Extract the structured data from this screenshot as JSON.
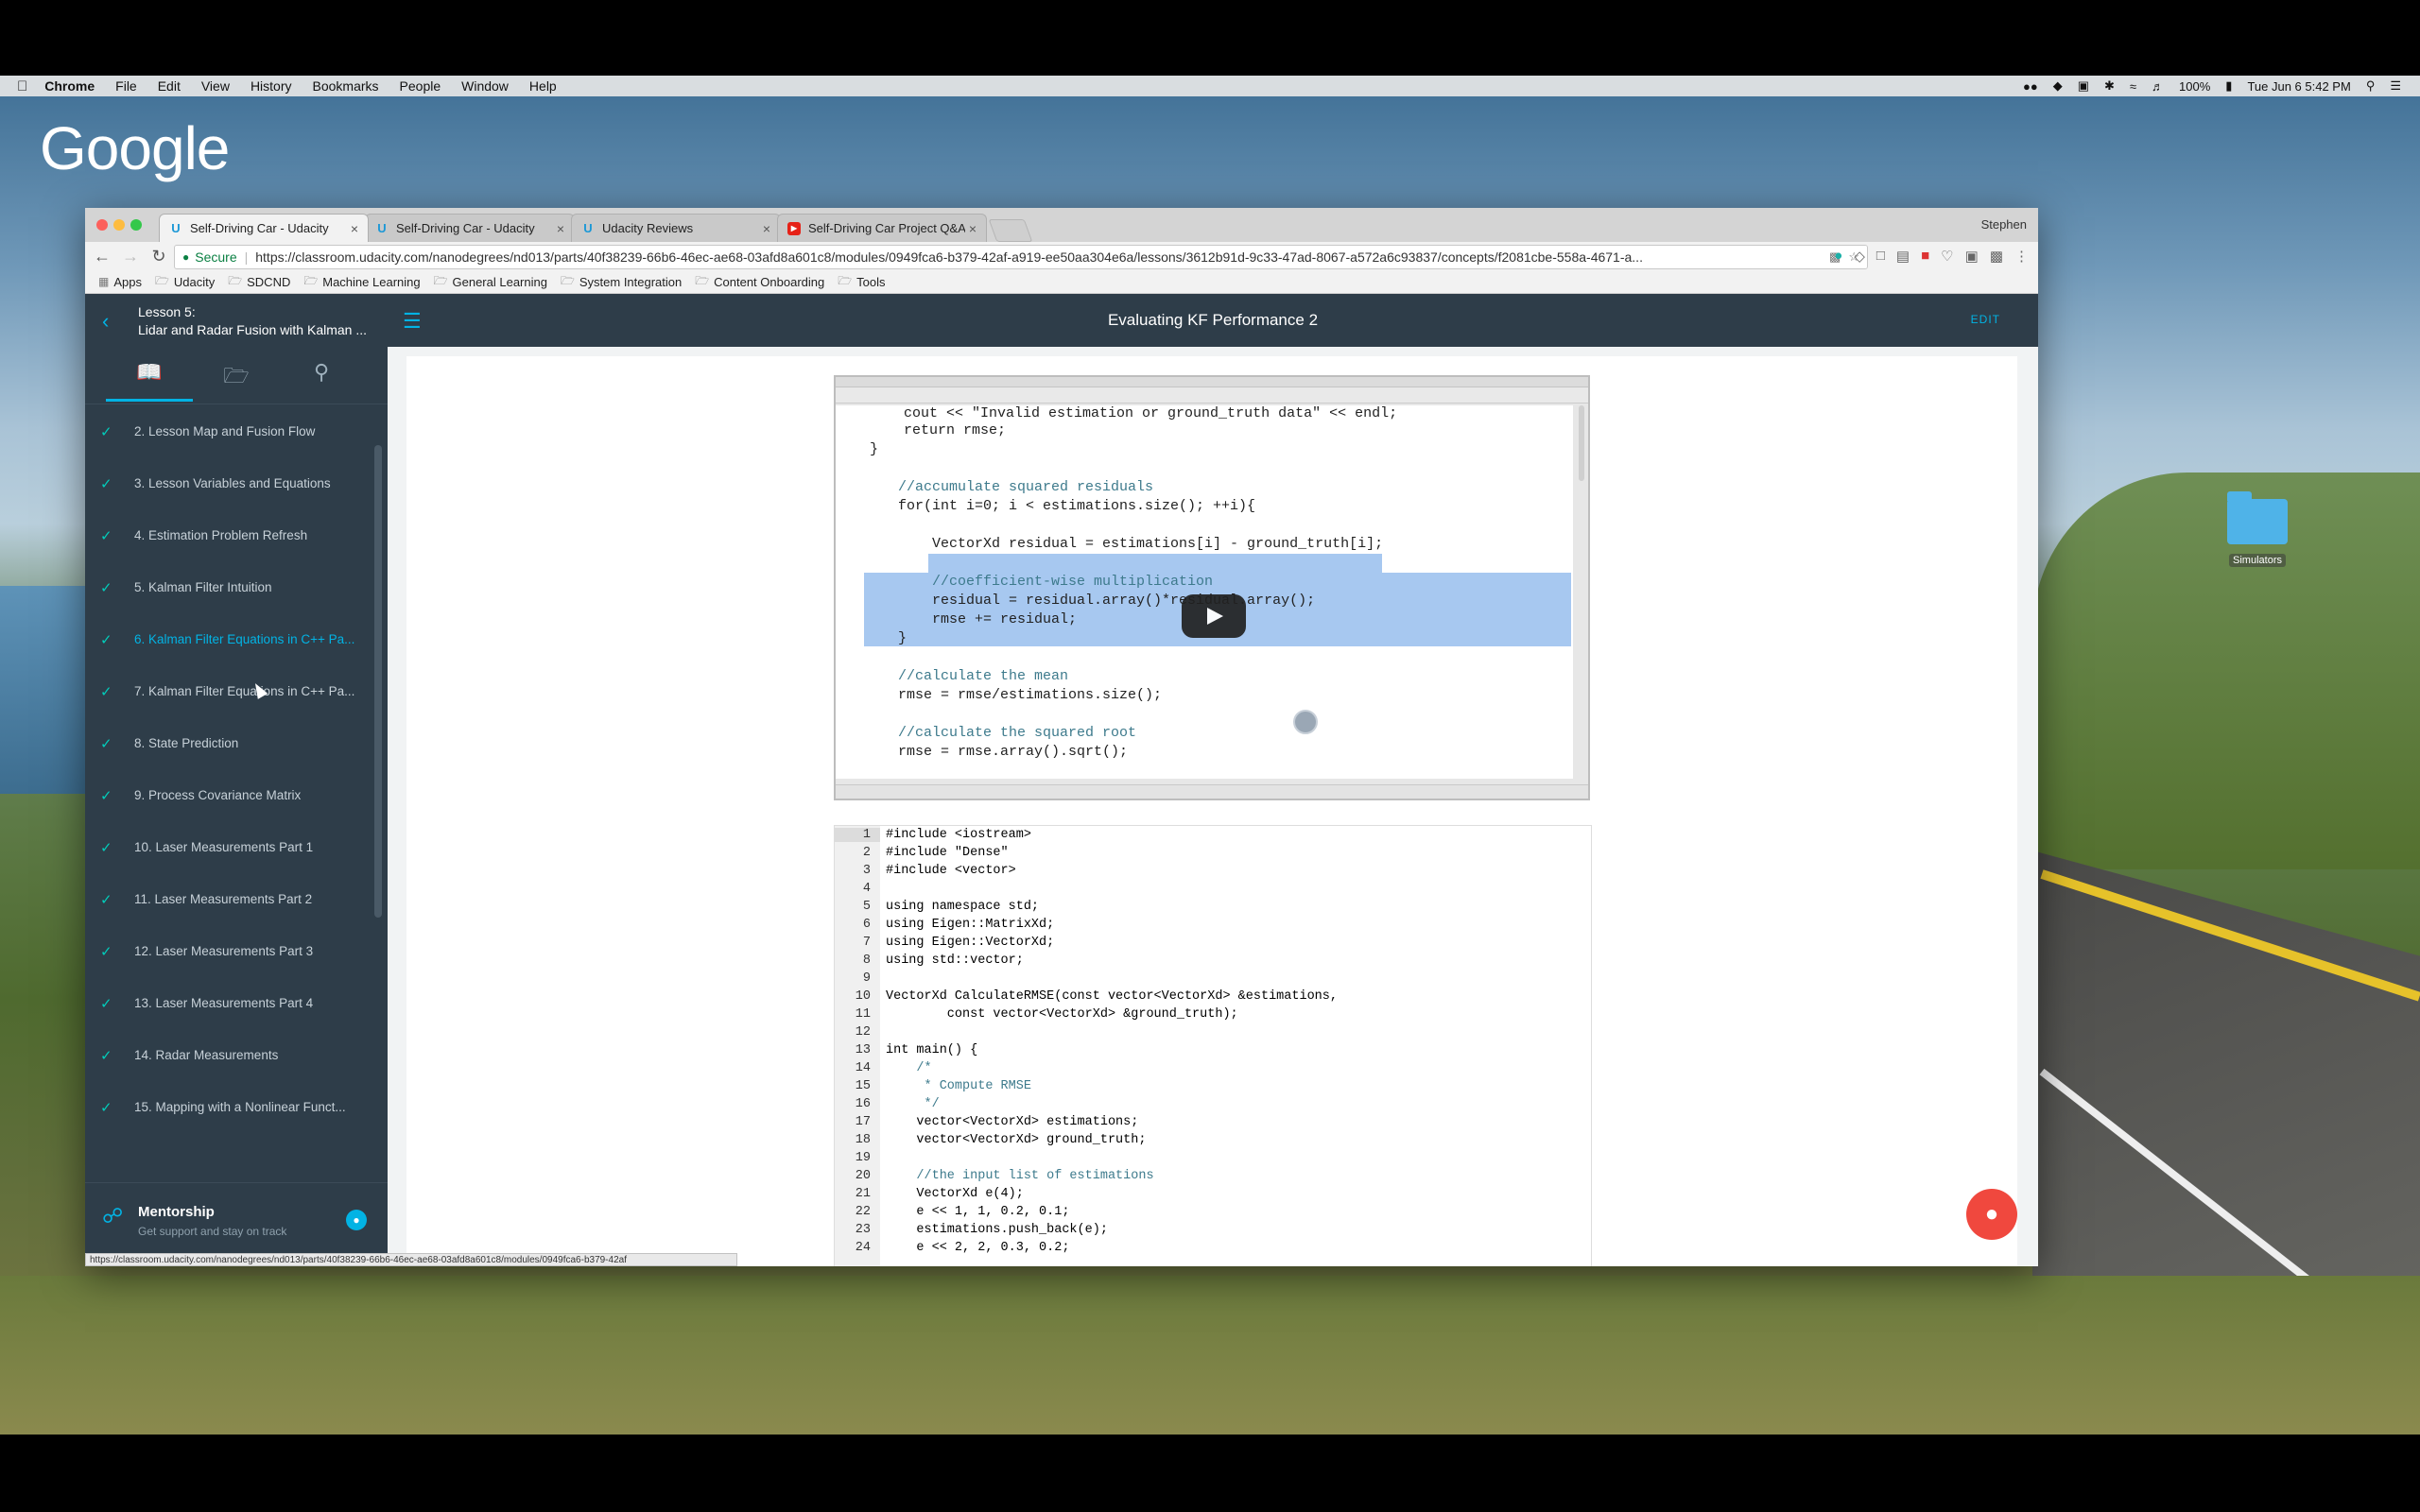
{
  "menubar": {
    "app": "Chrome",
    "items": [
      "File",
      "Edit",
      "View",
      "History",
      "Bookmarks",
      "People",
      "Window",
      "Help"
    ],
    "battery": "100%",
    "clock": "Tue Jun 6  5:42 PM"
  },
  "desktop": {
    "google_logo": "Google",
    "folder_label": "Simulators"
  },
  "browser": {
    "profile": "Stephen",
    "tabs": [
      {
        "title": "Self-Driving Car - Udacity",
        "active": true
      },
      {
        "title": "Self-Driving Car - Udacity",
        "active": false
      },
      {
        "title": "Udacity Reviews",
        "active": false
      },
      {
        "title": "Self-Driving Car Project Q&A",
        "active": false
      }
    ],
    "secure_label": "Secure",
    "url": "https://classroom.udacity.com/nanodegrees/nd013/parts/40f38239-66b6-46ec-ae68-03afd8a601c8/modules/0949fca6-b379-42af-a919-ee50aa304e6a/lessons/3612b91d-9c33-47ad-8067-a572a6c93837/concepts/f2081cbe-558a-4671-a...",
    "bookmarks": [
      "Apps",
      "Udacity",
      "SDCND",
      "Machine Learning",
      "General Learning",
      "System Integration",
      "Content Onboarding",
      "Tools"
    ],
    "status_url": "https://classroom.udacity.com/nanodegrees/nd013/parts/40f38239-66b6-46ec-ae68-03afd8a601c8/modules/0949fca6-b379-42af"
  },
  "sidebar": {
    "lesson_label": "Lesson 5:",
    "lesson_title": "Lidar and Radar Fusion with Kalman ...",
    "items": [
      {
        "label": "2. Lesson Map and Fusion Flow"
      },
      {
        "label": "3. Lesson Variables and Equations"
      },
      {
        "label": "4. Estimation Problem Refresh"
      },
      {
        "label": "5. Kalman Filter Intuition"
      },
      {
        "label": "6. Kalman Filter Equations in C++ Pa..."
      },
      {
        "label": "7. Kalman Filter Equations in C++ Pa..."
      },
      {
        "label": "8. State Prediction"
      },
      {
        "label": "9. Process Covariance Matrix"
      },
      {
        "label": "10. Laser Measurements Part 1"
      },
      {
        "label": "11. Laser Measurements Part 2"
      },
      {
        "label": "12. Laser Measurements Part 3"
      },
      {
        "label": "13. Laser Measurements Part 4"
      },
      {
        "label": "14. Radar Measurements"
      },
      {
        "label": "15. Mapping with a Nonlinear Funct..."
      }
    ],
    "current_index": 4,
    "mentorship_title": "Mentorship",
    "mentorship_sub": "Get support and stay on track"
  },
  "topbar": {
    "title": "Evaluating KF Performance 2",
    "edit": "EDIT"
  },
  "video_code": [
    "    cout << \"Invalid estimation or ground_truth data\" << endl;",
    "    return rmse;",
    "}",
    "",
    "//accumulate squared residuals",
    "for(int i=0; i < estimations.size(); ++i){",
    "",
    "    VectorXd residual = estimations[i] - ground_truth[i];",
    "",
    "    //coefficient-wise multiplication",
    "    residual = residual.array()*residual.array();",
    "    rmse += residual;",
    "}",
    "",
    "//calculate the mean",
    "rmse = rmse/estimations.size();",
    "",
    "//calculate the squared root",
    "rmse = rmse.array().sqrt();"
  ],
  "editor": {
    "lines": [
      "1",
      "2",
      "3",
      "4",
      "5",
      "6",
      "7",
      "8",
      "9",
      "10",
      "11",
      "12",
      "13",
      "14",
      "15",
      "16",
      "17",
      "18",
      "19",
      "20",
      "21",
      "22",
      "23",
      "24"
    ],
    "code": [
      "#include <iostream>",
      "#include \"Dense\"",
      "#include <vector>",
      "",
      "using namespace std;",
      "using Eigen::MatrixXd;",
      "using Eigen::VectorXd;",
      "using std::vector;",
      "",
      "VectorXd CalculateRMSE(const vector<VectorXd> &estimations,",
      "        const vector<VectorXd> &ground_truth);",
      "",
      "int main() {",
      "    /*",
      "     * Compute RMSE",
      "     */",
      "    vector<VectorXd> estimations;",
      "    vector<VectorXd> ground_truth;",
      "",
      "    //the input list of estimations",
      "    VectorXd e(4);",
      "    e << 1, 1, 0.2, 0.1;",
      "    estimations.push_back(e);",
      "    e << 2, 2, 0.3, 0.2;"
    ]
  }
}
